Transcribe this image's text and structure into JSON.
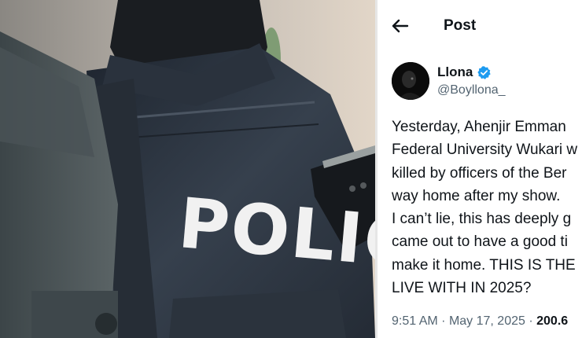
{
  "photo": {
    "vest_print": "POLIC"
  },
  "topbar": {
    "back_icon": "arrow-left-icon",
    "title": "Post"
  },
  "author": {
    "display_name": "Llona",
    "handle": "@Boyllona_",
    "verified_icon": "verified-badge-icon",
    "verified_color": "#1d9bf0"
  },
  "post": {
    "lines": [
      "Yesterday, Ahenjir Emman",
      "Federal University Wukari w",
      "killed by officers of the Ber",
      "way home after my show.",
      "I can’t lie, this has deeply g",
      "came out to have a good ti",
      "make it home. THIS IS THE",
      "LIVE WITH IN 2025?"
    ]
  },
  "meta": {
    "time": "9:51 AM",
    "separator": "·",
    "date": "May 17, 2025",
    "views": "200.6"
  },
  "colors": {
    "text_primary": "#0f1419",
    "text_secondary": "#536471",
    "vest": "#2f3845"
  }
}
